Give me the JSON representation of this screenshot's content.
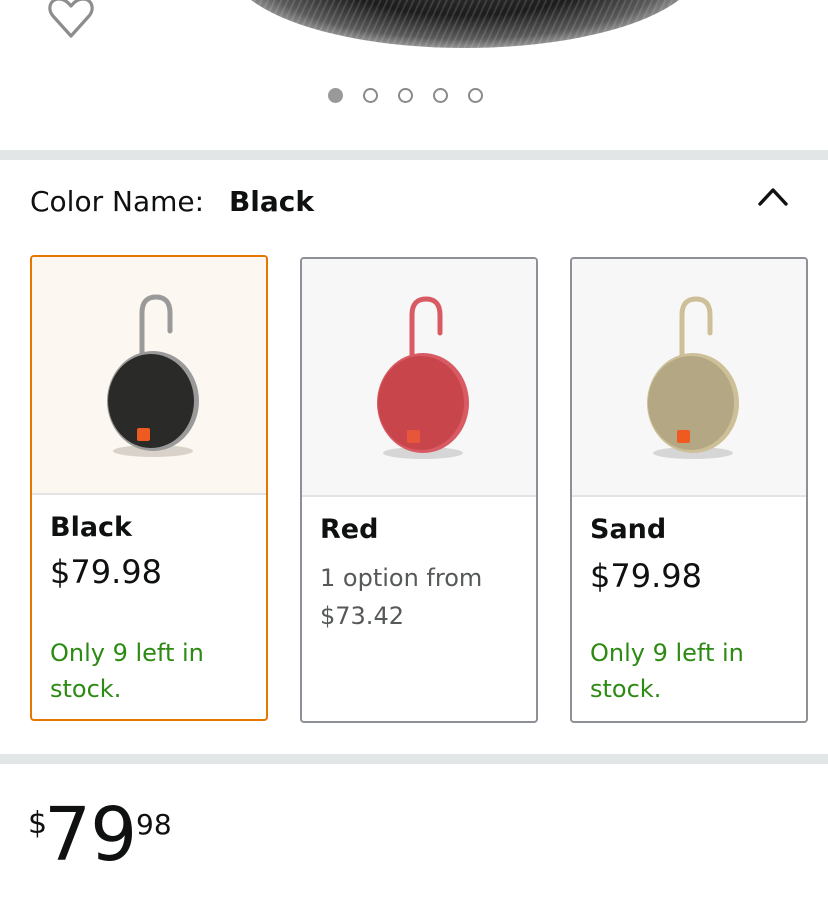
{
  "carousel": {
    "dot_count": 5,
    "active_index": 0
  },
  "color_selector": {
    "label": "Color Name:",
    "selected": "Black",
    "options": [
      {
        "name": "Black",
        "price": "$79.98",
        "stock": "Only 9 left in stock.",
        "selected": true,
        "body_color": "#2a2a28",
        "ring_color": "#9a9a9a",
        "bg_color": "#fcf7f1"
      },
      {
        "name": "Red",
        "option_text": "1 option from",
        "option_price": "$73.42",
        "selected": false,
        "body_color": "#c8454b",
        "ring_color": "#d85a62",
        "bg_color": "#f7f7f7"
      },
      {
        "name": "Sand",
        "price": "$79.98",
        "stock": "Only 9 left in stock.",
        "selected": false,
        "body_color": "#b3a784",
        "ring_color": "#cdbf97",
        "bg_color": "#f7f7f7"
      }
    ]
  },
  "price": {
    "symbol": "$",
    "whole": "79",
    "fraction": "98"
  },
  "colors": {
    "selected_border": "#e77600",
    "stock_green": "#2d8a13",
    "divider": "#e3e6e6"
  }
}
